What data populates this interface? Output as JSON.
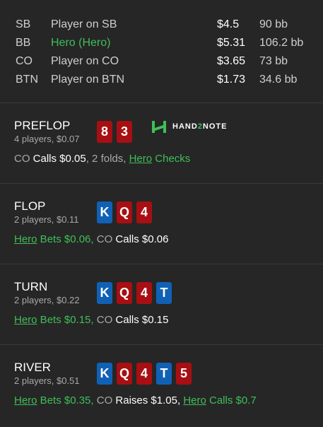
{
  "players": [
    {
      "position": "SB",
      "name": "Player on SB",
      "stack": "$4.5",
      "bb": "90 bb",
      "hero": false
    },
    {
      "position": "BB",
      "name": "Hero (Hero)",
      "stack": "$5.31",
      "bb": "106.2 bb",
      "hero": true
    },
    {
      "position": "CO",
      "name": "Player on CO",
      "stack": "$3.65",
      "bb": "73 bb",
      "hero": false
    },
    {
      "position": "BTN",
      "name": "Player on BTN",
      "stack": "$1.73",
      "bb": "34.6 bb",
      "hero": false
    }
  ],
  "logo": {
    "part1": "HAND",
    "part2": "2",
    "part3": "NOTE",
    "icon": "hand2note-logo-icon"
  },
  "streets": [
    {
      "name": "PREFLOP",
      "info": "4 players, $0.07",
      "cards": [
        {
          "rank": "8",
          "suit_color": "red"
        },
        {
          "rank": "3",
          "suit_color": "red"
        }
      ],
      "actions": [
        {
          "text": "CO",
          "style": "gray"
        },
        {
          "text": " Calls $0.05",
          "style": "white"
        },
        {
          "text": ", 2 folds, ",
          "style": "gray"
        },
        {
          "text": "Hero",
          "style": "hero"
        },
        {
          "text": " Checks",
          "style": "green"
        }
      ]
    },
    {
      "name": "FLOP",
      "info": "2 players, $0.11",
      "cards": [
        {
          "rank": "K",
          "suit_color": "blue"
        },
        {
          "rank": "Q",
          "suit_color": "red"
        },
        {
          "rank": "4",
          "suit_color": "red"
        }
      ],
      "actions": [
        {
          "text": "Hero",
          "style": "hero"
        },
        {
          "text": " Bets $0.06,",
          "style": "green"
        },
        {
          "text": " CO",
          "style": "gray"
        },
        {
          "text": " Calls $0.06",
          "style": "white"
        }
      ]
    },
    {
      "name": "TURN",
      "info": "2 players, $0.22",
      "cards": [
        {
          "rank": "K",
          "suit_color": "blue"
        },
        {
          "rank": "Q",
          "suit_color": "red"
        },
        {
          "rank": "4",
          "suit_color": "red"
        },
        {
          "rank": "T",
          "suit_color": "blue"
        }
      ],
      "actions": [
        {
          "text": "Hero",
          "style": "hero"
        },
        {
          "text": " Bets $0.15,",
          "style": "green"
        },
        {
          "text": " CO",
          "style": "gray"
        },
        {
          "text": " Calls $0.15",
          "style": "white"
        }
      ]
    },
    {
      "name": "RIVER",
      "info": "2 players, $0.51",
      "cards": [
        {
          "rank": "K",
          "suit_color": "blue"
        },
        {
          "rank": "Q",
          "suit_color": "red"
        },
        {
          "rank": "4",
          "suit_color": "red"
        },
        {
          "rank": "T",
          "suit_color": "blue"
        },
        {
          "rank": "5",
          "suit_color": "red"
        }
      ],
      "actions": [
        {
          "text": "Hero",
          "style": "hero"
        },
        {
          "text": " Bets $0.35,",
          "style": "green"
        },
        {
          "text": " CO",
          "style": "gray"
        },
        {
          "text": " Raises $1.05, ",
          "style": "white"
        },
        {
          "text": "Hero",
          "style": "hero"
        },
        {
          "text": " Calls $0.7",
          "style": "green"
        }
      ]
    }
  ],
  "colors": {
    "hero_green": "#3fbf58",
    "card_red": "#a80f12",
    "card_blue": "#1061b5",
    "background": "#262626"
  }
}
